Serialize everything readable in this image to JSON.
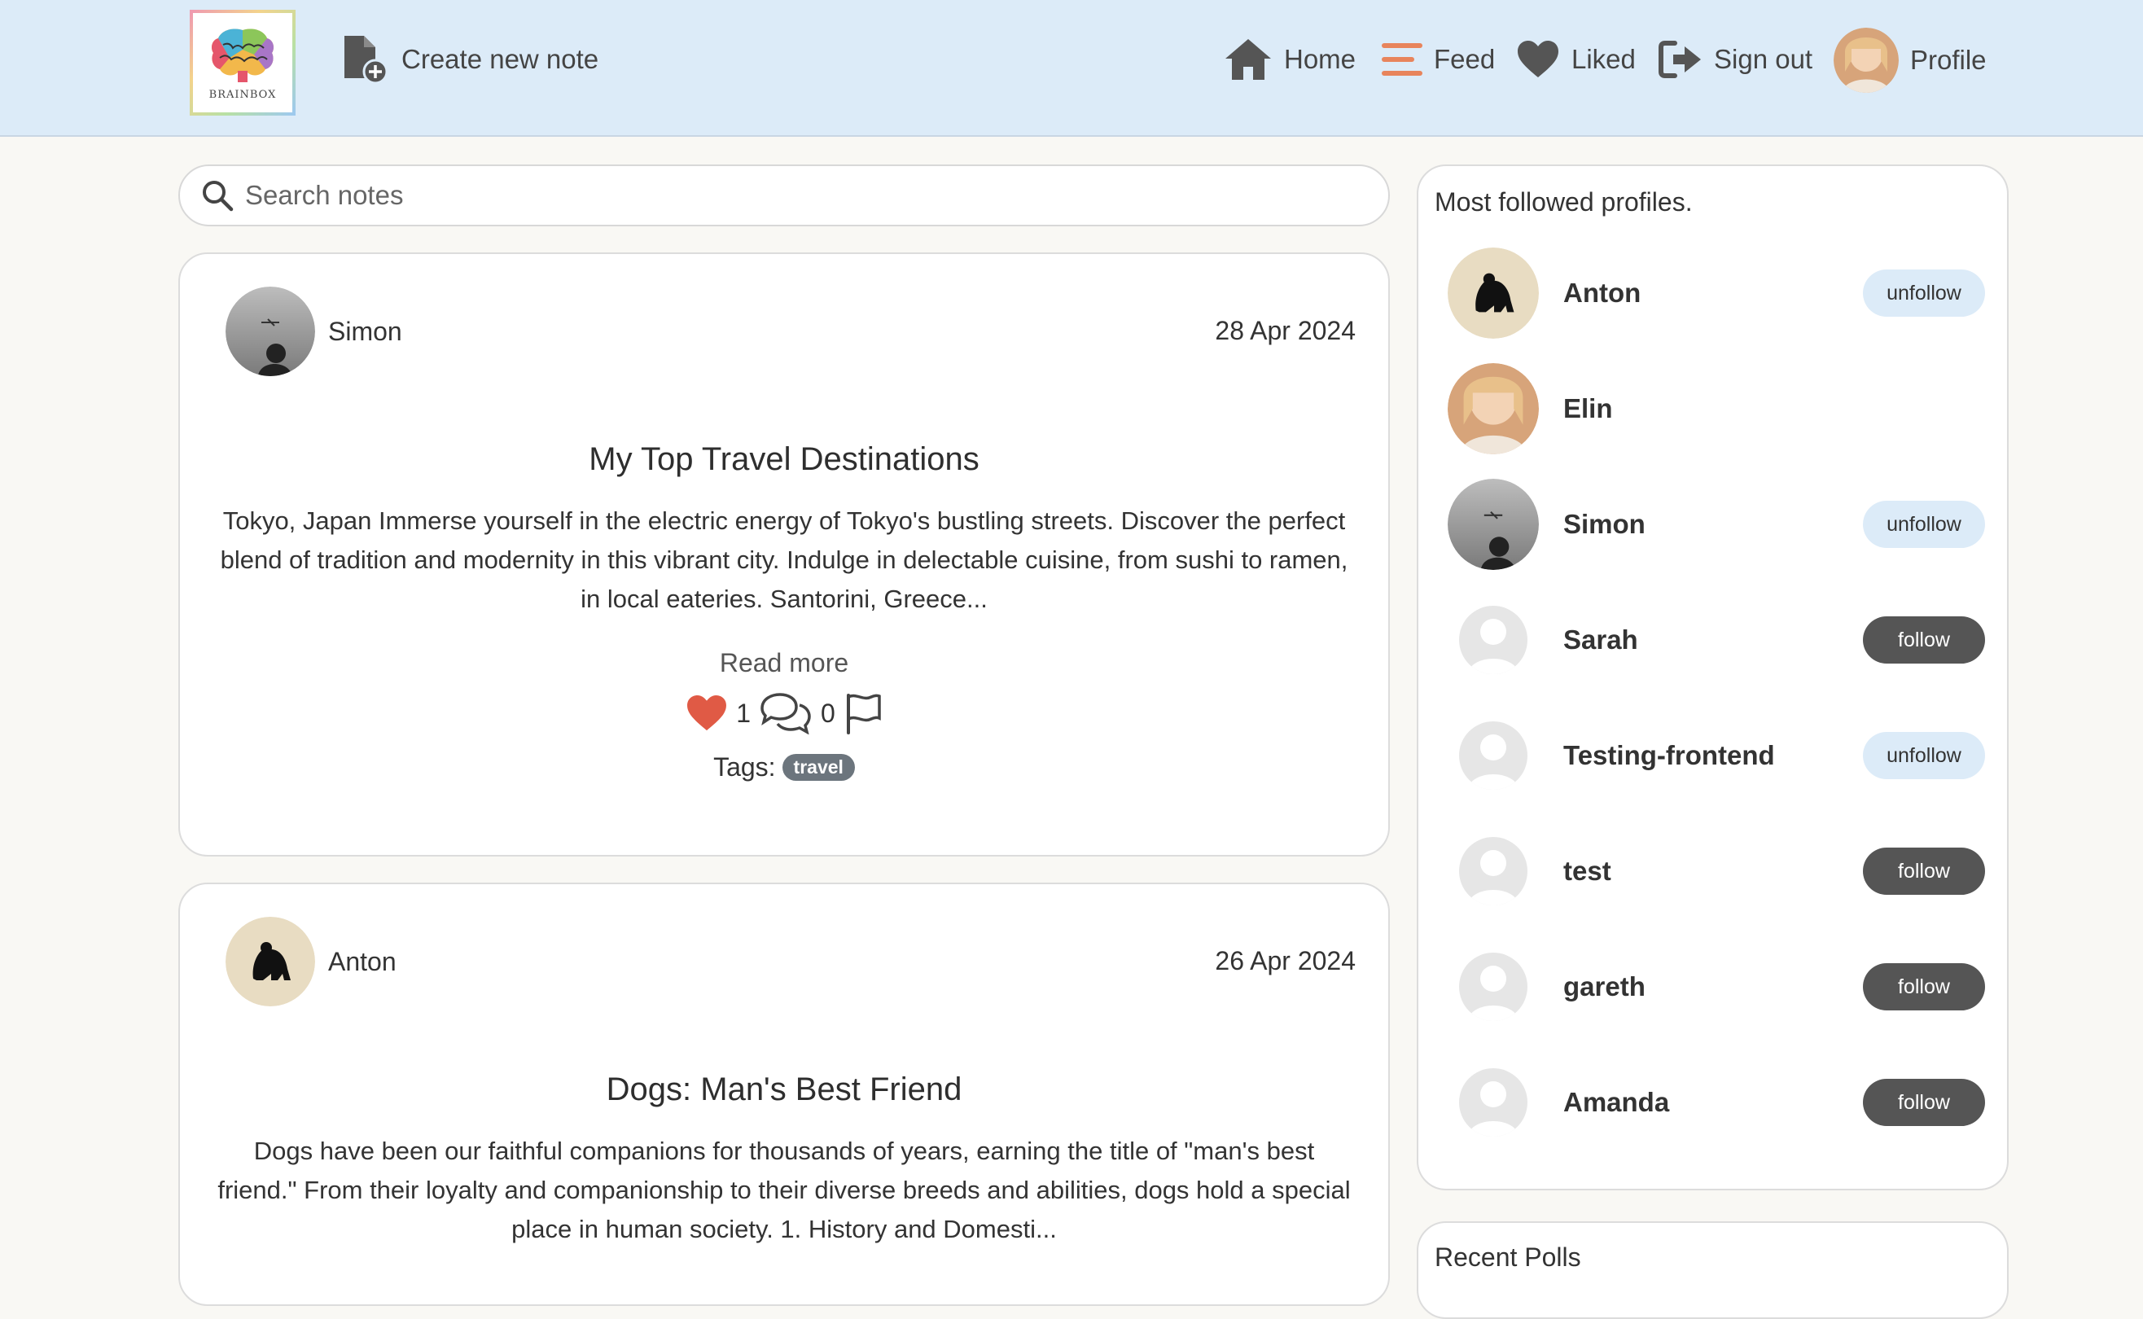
{
  "app": {
    "logo_text": "BRAINBOX"
  },
  "nav": {
    "create_note": "Create new note",
    "home": "Home",
    "feed": "Feed",
    "liked": "Liked",
    "sign_out": "Sign out",
    "profile": "Profile"
  },
  "search": {
    "placeholder": "Search notes",
    "value": ""
  },
  "notes": [
    {
      "author": "Simon",
      "date": "28 Apr 2024",
      "title": "My Top Travel Destinations",
      "excerpt": "Tokyo, Japan Immerse yourself in the electric energy of Tokyo's bustling streets. Discover the perfect blend of tradition and modernity in this vibrant city. Indulge in delectable cuisine, from sushi to ramen, in local eateries. Santorini, Greece...",
      "read_more": "Read more",
      "likes": "1",
      "comments": "0",
      "tags_label": "Tags:",
      "tags": [
        "travel"
      ]
    },
    {
      "author": "Anton",
      "date": "26 Apr 2024",
      "title": "Dogs: Man's Best Friend",
      "excerpt": "Dogs have been our faithful companions for thousands of years, earning the title of \"man's best friend.\" From their loyalty and companionship to their diverse breeds and abilities, dogs hold a special place in human society. 1. History and Domesti..."
    }
  ],
  "sidebar": {
    "heading": "Most followed profiles.",
    "profiles": [
      {
        "name": "Anton",
        "action": "unfollow"
      },
      {
        "name": "Elin",
        "action": ""
      },
      {
        "name": "Simon",
        "action": "unfollow"
      },
      {
        "name": "Sarah",
        "action": "follow"
      },
      {
        "name": "Testing-frontend",
        "action": "unfollow"
      },
      {
        "name": "test",
        "action": "follow"
      },
      {
        "name": "gareth",
        "action": "follow"
      },
      {
        "name": "Amanda",
        "action": "follow"
      }
    ],
    "recent_heading": "Recent Polls"
  },
  "colors": {
    "navbar_bg": "#dcebf8",
    "accent_orange": "#e8845c",
    "like_red": "#e05a45",
    "follow_btn": "#555555",
    "unfollow_btn": "#dcebf8",
    "tag_bg": "#6c757d"
  },
  "icons": {
    "create_note": "file-plus-icon",
    "home": "home-icon",
    "feed": "bars-icon",
    "liked": "heart-icon",
    "sign_out": "sign-out-icon",
    "search": "search-icon",
    "like": "heart-icon",
    "comments": "comments-icon",
    "report": "flag-icon"
  }
}
